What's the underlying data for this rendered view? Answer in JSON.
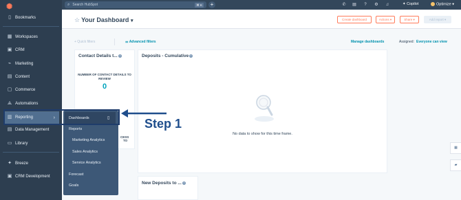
{
  "topbar": {
    "search_placeholder": "Search HubSpot",
    "shortcut": "⌘ K",
    "copilot_label": "Copilot",
    "account_label": "Optimize"
  },
  "sidebar": {
    "items": [
      {
        "label": "Bookmarks",
        "icon": "bookmark-icon"
      },
      {
        "label": "Workspaces",
        "icon": "workspaces-icon"
      },
      {
        "label": "CRM",
        "icon": "crm-icon"
      },
      {
        "label": "Marketing",
        "icon": "marketing-icon"
      },
      {
        "label": "Content",
        "icon": "content-icon"
      },
      {
        "label": "Commerce",
        "icon": "commerce-icon"
      },
      {
        "label": "Automations",
        "icon": "automations-icon"
      },
      {
        "label": "Reporting",
        "icon": "reporting-icon"
      },
      {
        "label": "Data Management",
        "icon": "data-management-icon"
      },
      {
        "label": "Library",
        "icon": "library-icon"
      },
      {
        "label": "Breeze",
        "icon": "breeze-icon"
      },
      {
        "label": "CRM Development",
        "icon": "crm-development-icon"
      }
    ]
  },
  "submenu": {
    "items": [
      "Dashboards",
      "Reports",
      "Marketing Analytics",
      "Sales Analytics",
      "Service Analytics",
      "Forecast",
      "Goals"
    ]
  },
  "header": {
    "title": "Your Dashboard",
    "create_dashboard": "Create dashboard",
    "actions": "Actions ▾",
    "share": "Share ▾",
    "add_report": "Add report ▾"
  },
  "filters": {
    "quick_filters": "+ Quick filters",
    "advanced_filters": "Advanced filters",
    "manage_dashboards": "Manage dashboards",
    "assigned_label": "Assigned:",
    "assigned_value": "Everyone can view"
  },
  "cards": {
    "contact_details": {
      "title": "Contact Details t...",
      "metric_label": "NUMBER OF CONTACT DETAILS TO REVIEW",
      "metric_value": "0",
      "partial_text_1": "CESS",
      "partial_text_2": "TO"
    },
    "deposits": {
      "title": "Deposits - Cumulative",
      "empty_text": "No data to show for this time frame."
    },
    "new_deposits": {
      "title": "New Deposits to ..."
    }
  },
  "annotation": {
    "step_label": "Step 1"
  },
  "colors": {
    "sidebar_bg": "#2d3e50",
    "accent": "#ff7a59",
    "teal": "#00a4bd",
    "annotation": "#1f4e8c"
  }
}
